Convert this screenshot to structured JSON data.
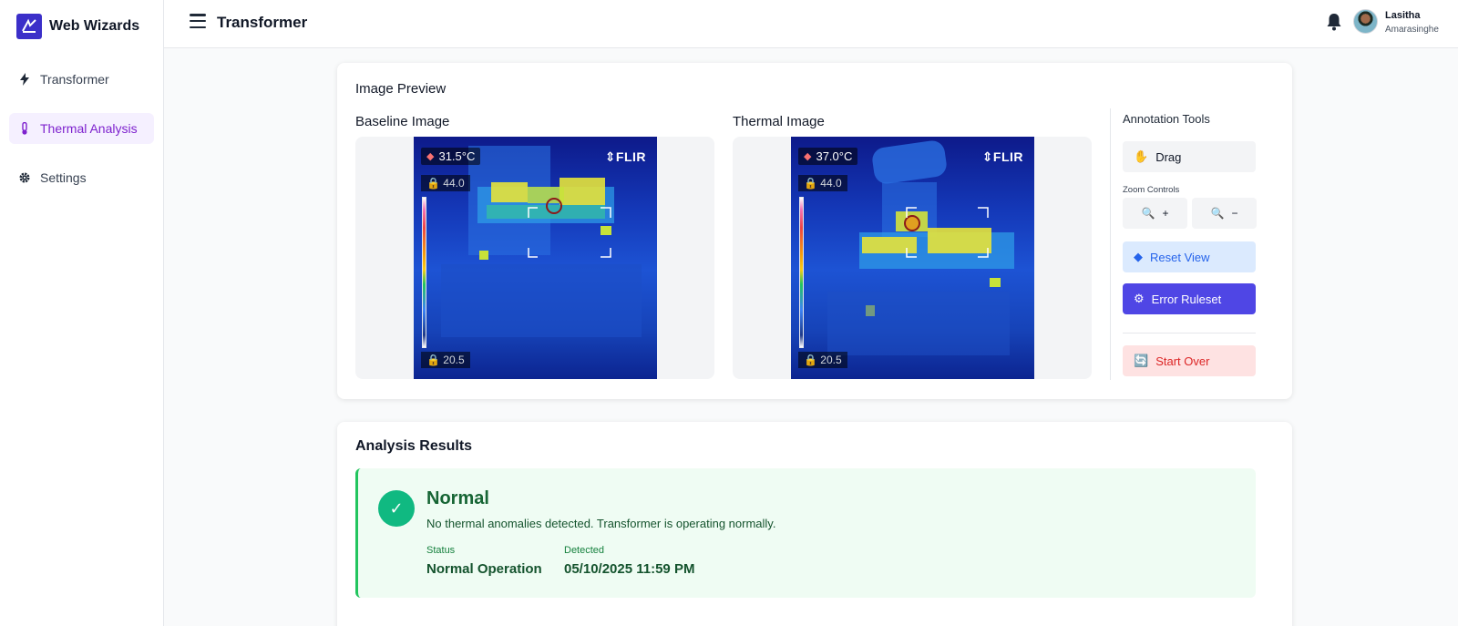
{
  "brand": {
    "name": "Web Wizards"
  },
  "sidebar": {
    "items": [
      {
        "label": "Transformer",
        "icon": "bolt-icon"
      },
      {
        "label": "Thermal Analysis",
        "icon": "thermometer-icon",
        "active": true
      },
      {
        "label": "Settings",
        "icon": "gear-icon"
      }
    ]
  },
  "header": {
    "title": "Transformer",
    "user": {
      "first_name": "Lasitha",
      "last_name": "Amarasinghe"
    }
  },
  "preview": {
    "title": "Image Preview",
    "baseline": {
      "label": "Baseline Image",
      "temp": "31.5°C",
      "max": "44.0",
      "min": "20.5",
      "brand": "FLIR"
    },
    "thermal": {
      "label": "Thermal Image",
      "temp": "37.0°C",
      "max": "44.0",
      "min": "20.5",
      "brand": "FLIR"
    }
  },
  "tools": {
    "title": "Annotation Tools",
    "drag_label": "Drag",
    "zoom_label": "Zoom Controls",
    "zoom_in_label": "+",
    "zoom_out_label": "−",
    "reset_label": "Reset View",
    "ruleset_label": "Error Ruleset",
    "start_over_label": "Start Over"
  },
  "results": {
    "title": "Analysis Results",
    "status_title": "Normal",
    "description": "No thermal anomalies detected. Transformer is operating normally.",
    "status_label": "Status",
    "status_value": "Normal Operation",
    "detected_label": "Detected",
    "detected_value": "05/10/2025 11:59 PM"
  },
  "colors": {
    "accent": "#4f46e5",
    "active_nav": "#7e22ce",
    "success": "#22c55e",
    "danger": "#dc2626"
  }
}
